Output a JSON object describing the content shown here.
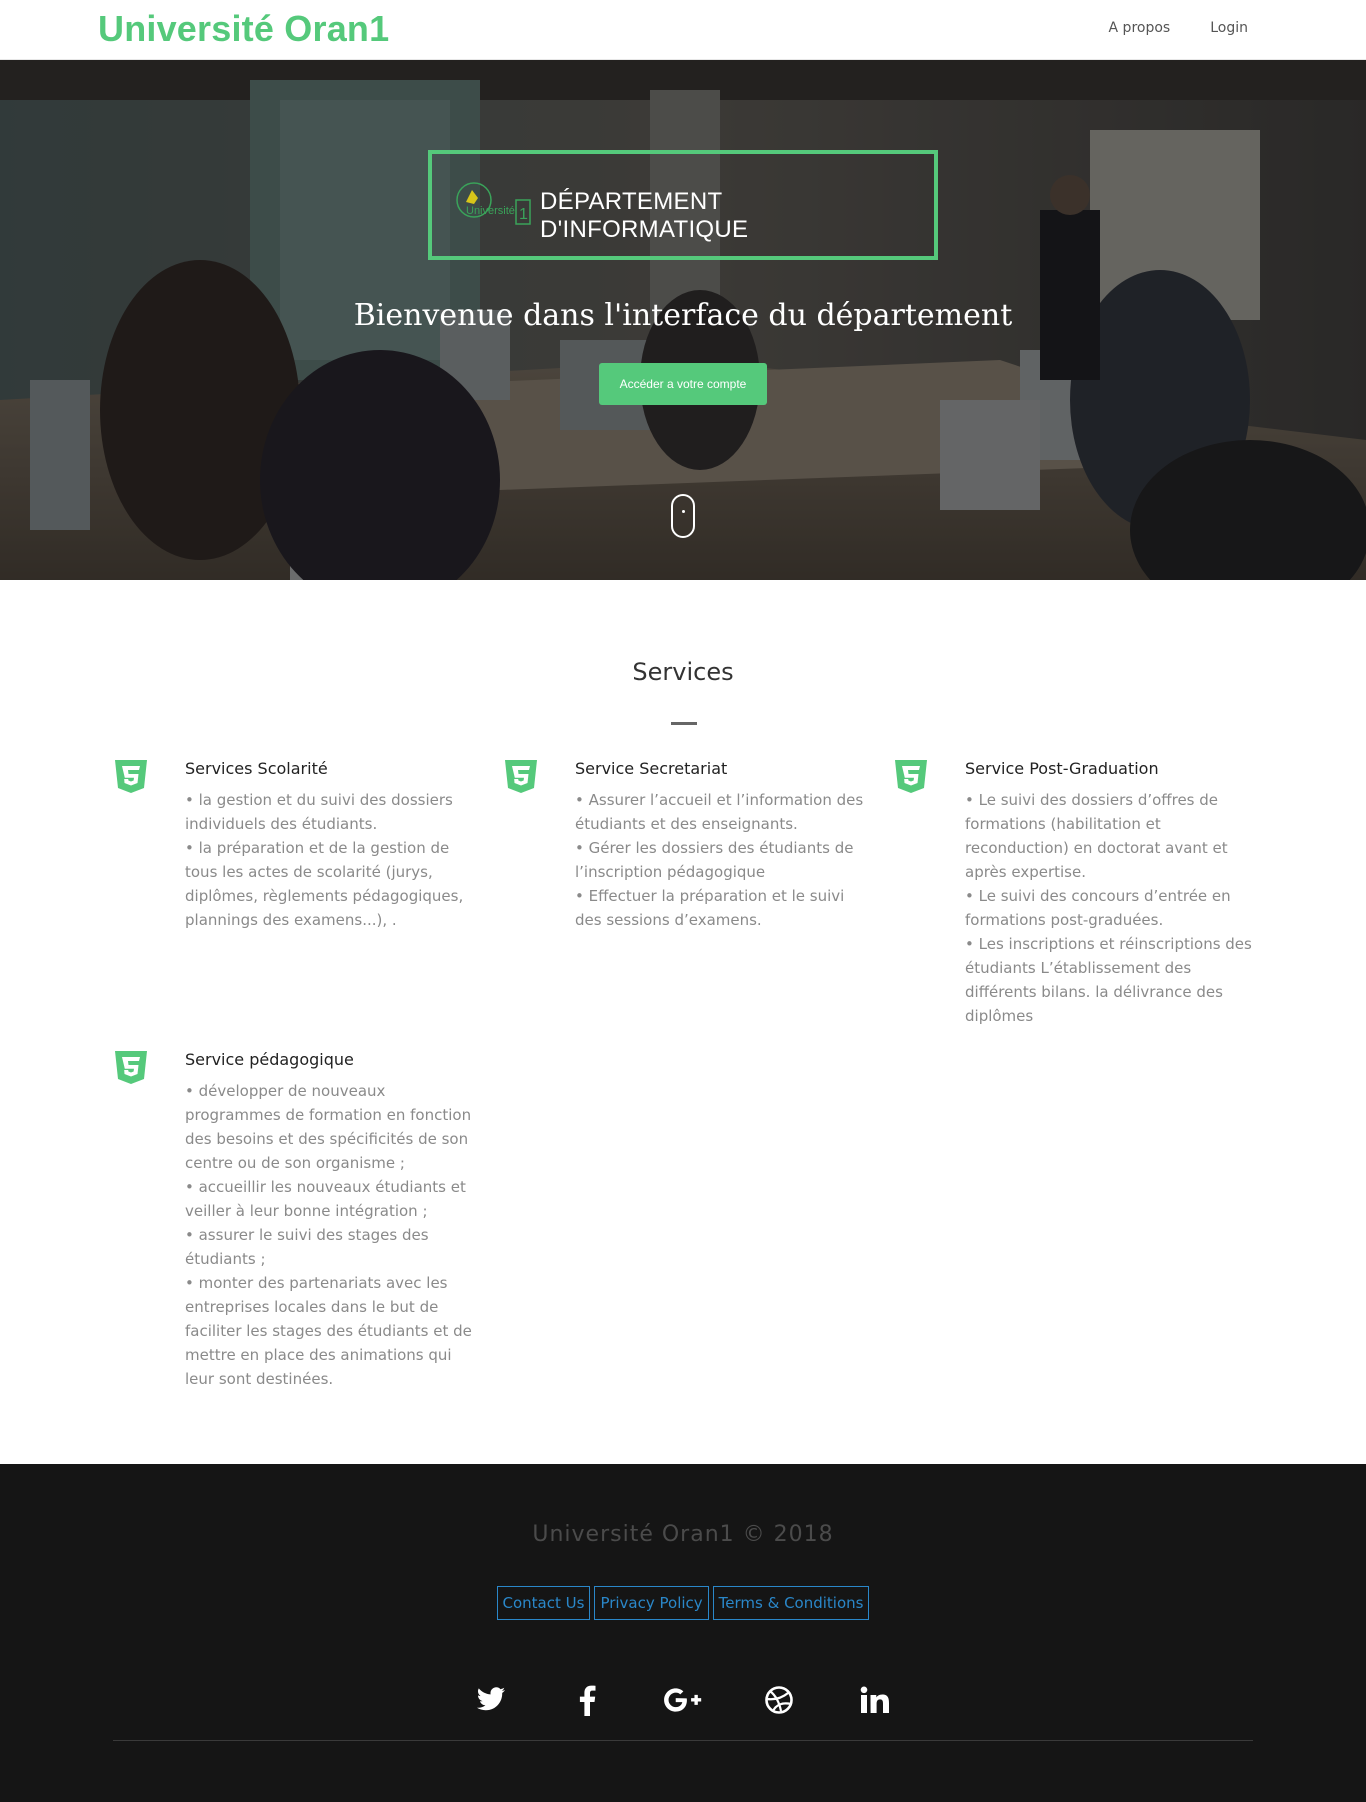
{
  "navbar": {
    "brand": "Université Oran1",
    "links": [
      {
        "label": "A propos"
      },
      {
        "label": "Login"
      }
    ]
  },
  "hero": {
    "department_title": "DÉPARTEMENT D'INFORMATIQUE",
    "logo_text": "Université",
    "logo_number": "1",
    "welcome": "Bienvenue dans l'interface du département",
    "cta_label": "Accéder a votre compte"
  },
  "services": {
    "title": "Services",
    "accent_color": "#55c97b",
    "items": [
      {
        "icon": "css3-icon",
        "title": "Services Scolarité",
        "lines": [
          "• la gestion et du suivi des dossiers",
          "individuels des étudiants.",
          "• la préparation et de la gestion de",
          "tous les actes de scolarité (jurys,",
          "diplômes, règlements pédagogiques,",
          "plannings des examens...), ."
        ]
      },
      {
        "icon": "css3-icon",
        "title": "Service Secretariat",
        "lines": [
          "• Assurer l’accueil et l’information des",
          "étudiants et des enseignants.",
          "• Gérer les dossiers des étudiants de",
          "l’inscription pédagogique",
          "• Effectuer la préparation et le suivi",
          "des sessions d’examens."
        ]
      },
      {
        "icon": "css3-icon",
        "title": "Service Post-Graduation",
        "lines": [
          "• Le suivi des dossiers d’offres de",
          "formations (habilitation et",
          "reconduction) en doctorat avant et",
          "après expertise.",
          "• Le suivi des concours d’entrée en",
          "formations post-graduées.",
          "• Les inscriptions et réinscriptions des",
          "étudiants L’établissement des",
          "différents bilans. la délivrance des",
          "diplômes"
        ]
      },
      {
        "icon": "css3-icon",
        "title": "Service pédagogique",
        "lines": [
          "• développer de nouveaux",
          "programmes de formation en fonction",
          "des besoins et des spécificités de son",
          "centre ou de son organisme ;",
          "• accueillir les nouveaux étudiants et",
          "veiller à leur bonne intégration ;",
          "• assurer le suivi des stages des",
          "étudiants ;",
          "• monter des partenariats avec les",
          "entreprises locales dans le but de",
          "faciliter les stages des étudiants et de",
          "mettre en place des animations qui",
          "leur sont destinées."
        ]
      }
    ]
  },
  "footer": {
    "copyright": "Université Oran1 © 2018",
    "links": [
      {
        "label": "Contact Us"
      },
      {
        "label": "Privacy Policy"
      },
      {
        "label": "Terms & Conditions"
      }
    ],
    "link_color": "#2a87c9",
    "socials": [
      "twitter-icon",
      "facebook-icon",
      "google-plus-icon",
      "dribbble-icon",
      "linkedin-icon"
    ]
  }
}
